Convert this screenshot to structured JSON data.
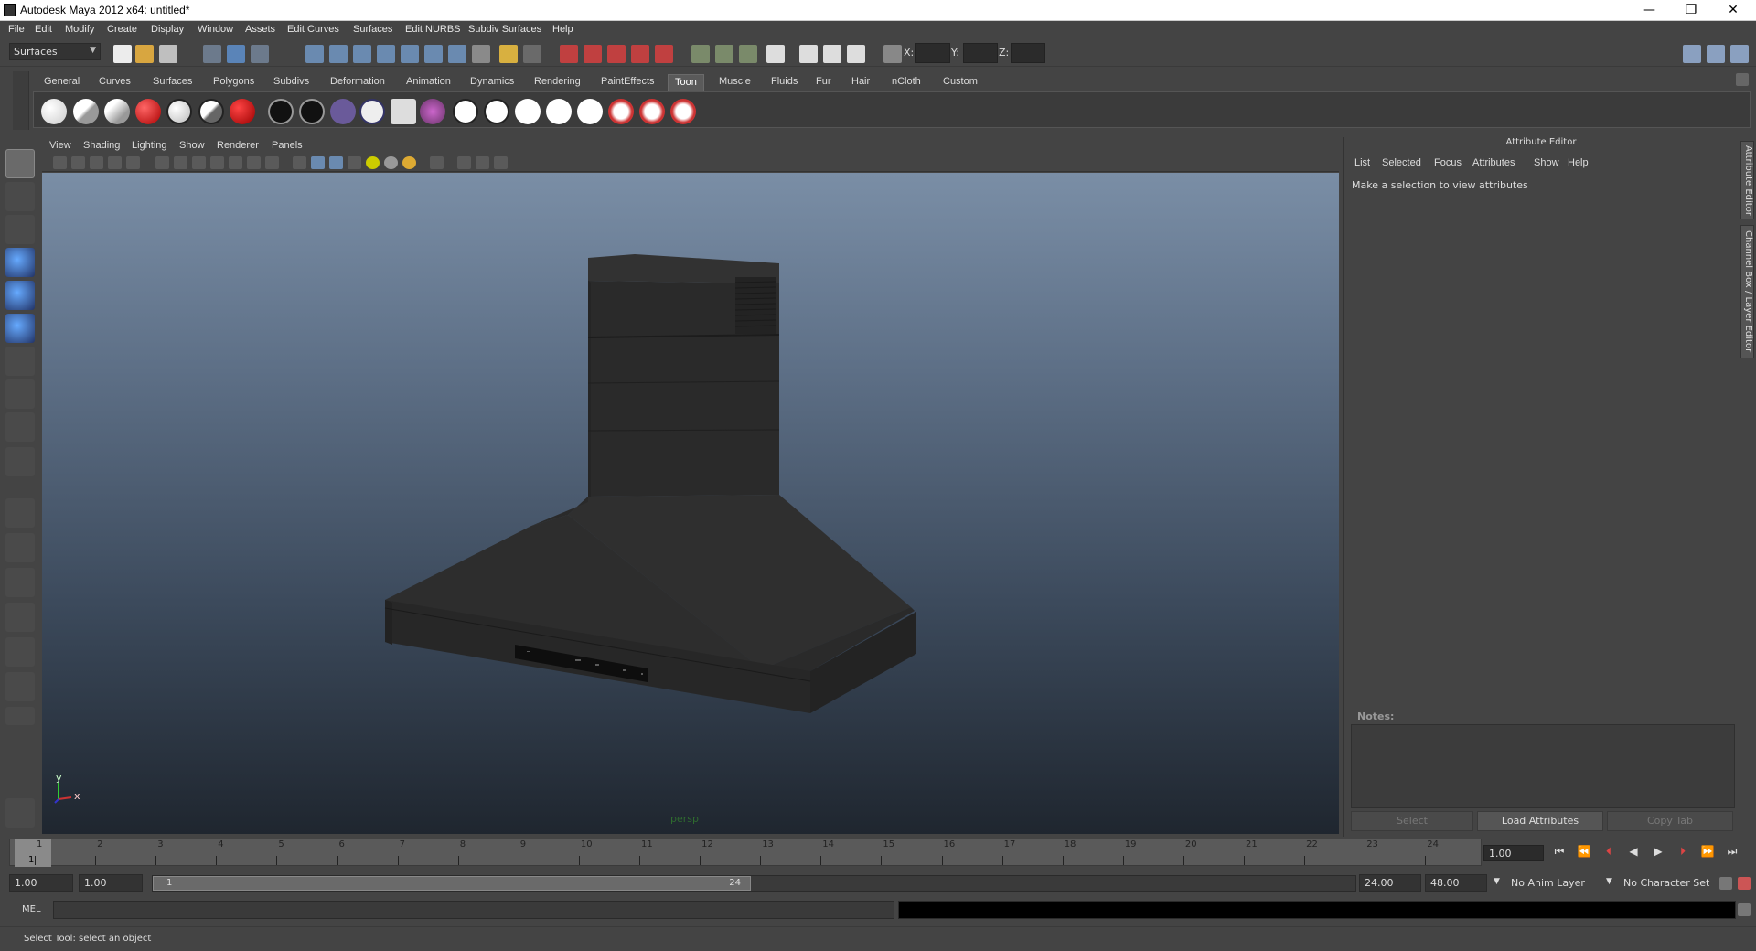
{
  "window": {
    "title": "Autodesk Maya 2012 x64: untitled*",
    "min_glyph": "—",
    "restore_glyph": "❐",
    "close_glyph": "✕"
  },
  "menubar": [
    "File",
    "Edit",
    "Modify",
    "Create",
    "Display",
    "Window",
    "Assets",
    "Edit Curves",
    "Surfaces",
    "Edit NURBS",
    "Subdiv Surfaces",
    "Help"
  ],
  "statusline": {
    "mode": "Surfaces",
    "x_label": "X:",
    "y_label": "Y:",
    "z_label": "Z:"
  },
  "shelf": {
    "tabs": [
      "General",
      "Curves",
      "Surfaces",
      "Polygons",
      "Subdivs",
      "Deformation",
      "Animation",
      "Dynamics",
      "Rendering",
      "PaintEffects",
      "Toon",
      "Muscle",
      "Fluids",
      "Fur",
      "Hair",
      "nCloth",
      "Custom"
    ],
    "active_tab": "Toon"
  },
  "panel": {
    "menus": [
      "View",
      "Shading",
      "Lighting",
      "Show",
      "Renderer",
      "Panels"
    ],
    "camera": "persp",
    "axis_y": "y",
    "axis_x": "x"
  },
  "attribute_editor": {
    "title": "Attribute Editor",
    "menus": [
      "List",
      "Selected",
      "Focus",
      "Attributes",
      "Show",
      "Help"
    ],
    "message": "Make a selection to view attributes",
    "notes_label": "Notes:",
    "buttons": {
      "select": "Select",
      "load": "Load Attributes",
      "copy": "Copy Tab"
    }
  },
  "side_tabs": [
    "Attribute Editor",
    "Channel Box / Layer Editor"
  ],
  "timeslider": {
    "ticks": [
      "1",
      "2",
      "3",
      "4",
      "5",
      "6",
      "7",
      "8",
      "9",
      "10",
      "11",
      "12",
      "13",
      "14",
      "15",
      "16",
      "17",
      "18",
      "19",
      "20",
      "21",
      "22",
      "23",
      "24"
    ],
    "current_frame_marker": "1",
    "current_time": "1.00"
  },
  "range": {
    "start_time": "1.00",
    "playback_start": "1.00",
    "handle_start": "1",
    "handle_end": "24",
    "playback_end": "24.00",
    "end_time": "48.00",
    "anim_layer": "No Anim Layer",
    "character_set": "No Character Set"
  },
  "command": {
    "label": "MEL"
  },
  "help_line": "Select Tool: select an object",
  "colors": {
    "bg": "#444444",
    "viewport_top": "#7a8ea6",
    "viewport_bottom": "#1f262f",
    "model": "#2b2b2b"
  }
}
